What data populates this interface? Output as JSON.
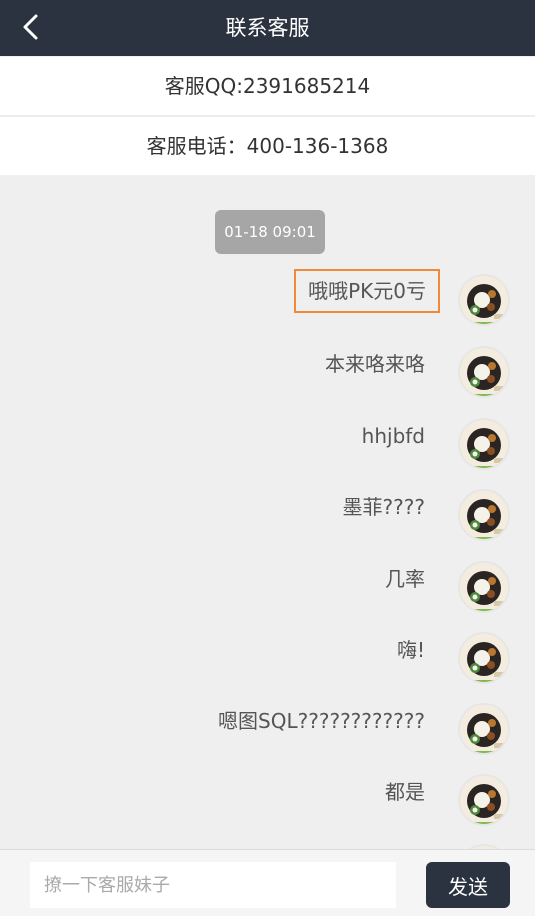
{
  "header": {
    "title": "联系客服",
    "back_icon": "chevron-left-icon"
  },
  "info": {
    "qq": "客服QQ:2391685214",
    "phone": "客服电话：400-136-1368"
  },
  "chat": {
    "timestamp": "01-18 09:01",
    "messages": [
      {
        "text": "哦哦PK元0亏",
        "selected": true
      },
      {
        "text": "本来咯来咯"
      },
      {
        "text": "hhjbfd"
      },
      {
        "text": "墨菲????"
      },
      {
        "text": "几率"
      },
      {
        "text": "嗨!"
      },
      {
        "text": "嗯图SQL????????????"
      },
      {
        "text": "都是"
      }
    ],
    "avatar_icon": "food-avatar-icon"
  },
  "composer": {
    "placeholder": "撩一下客服妹子",
    "value": "",
    "send_label": "发送"
  },
  "colors": {
    "header": "#2b3340",
    "highlight": "#f0893b",
    "timestamp_bg": "#a6a6a6"
  }
}
